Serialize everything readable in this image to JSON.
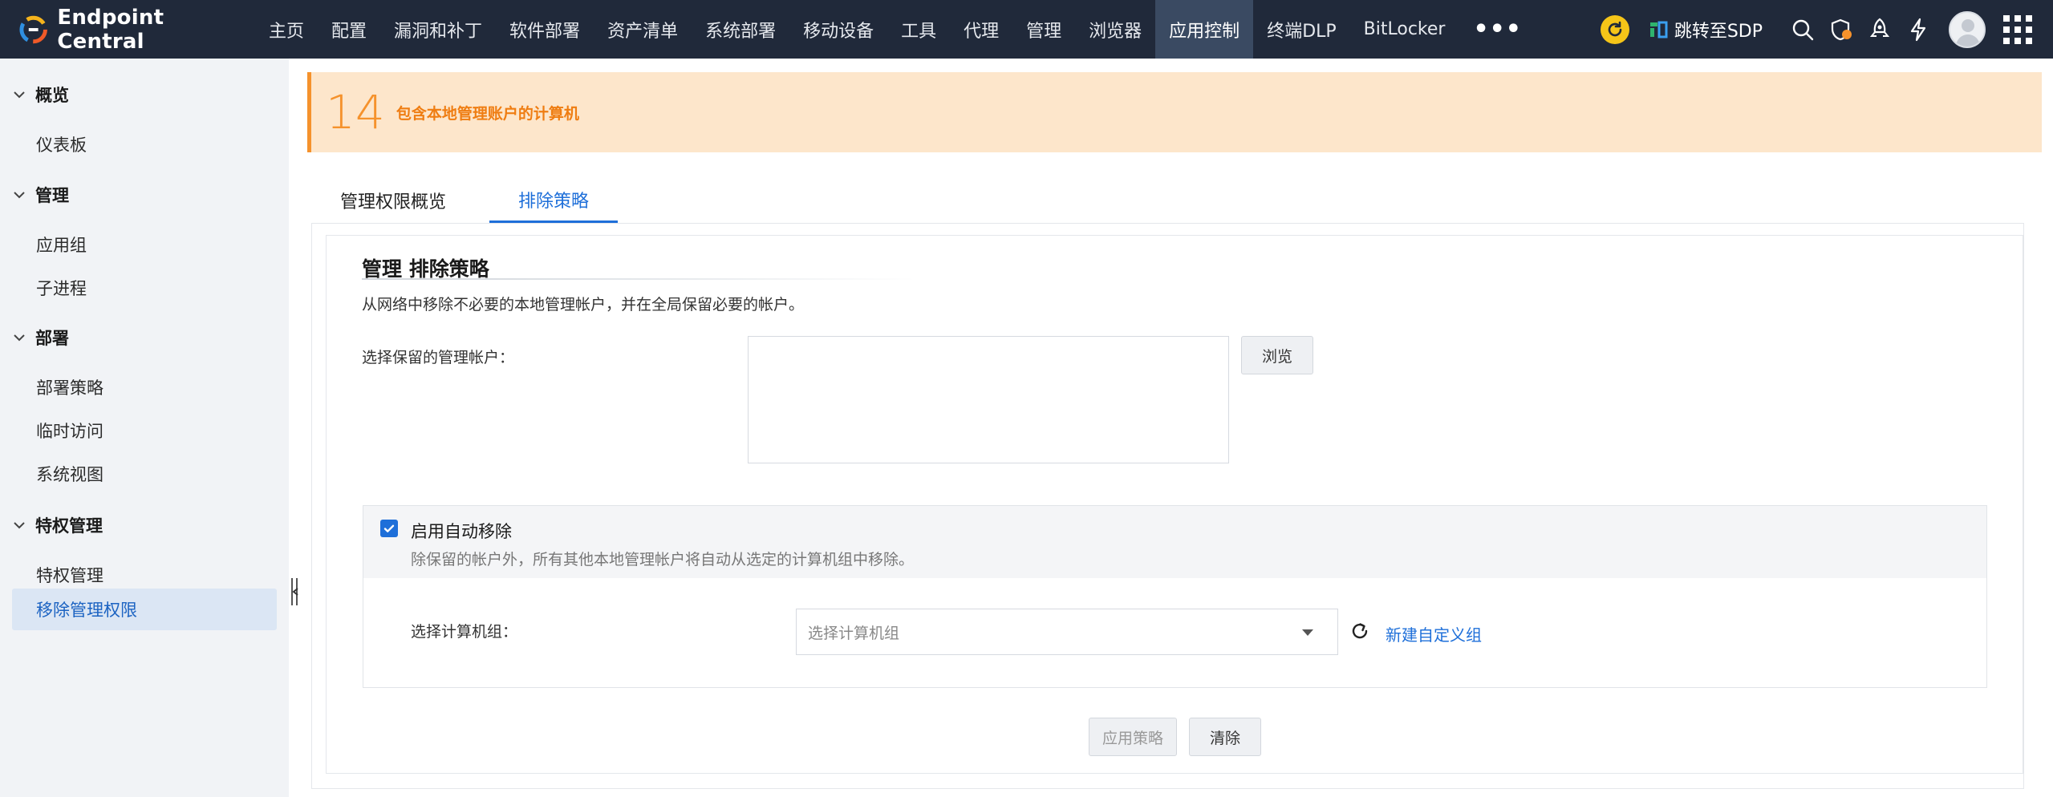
{
  "brand": {
    "name": "Endpoint Central"
  },
  "nav": {
    "items": [
      "主页",
      "配置",
      "漏洞和补丁",
      "软件部署",
      "资产清单",
      "系统部署",
      "移动设备",
      "工具",
      "代理",
      "管理",
      "浏览器",
      "应用控制",
      "终端DLP",
      "BitLocker"
    ],
    "active": "应用控制",
    "more": "•••"
  },
  "topright": {
    "sdp_label": "跳转至SDP"
  },
  "sidebar": {
    "groups": [
      {
        "title": "概览",
        "items": [
          "仪表板"
        ]
      },
      {
        "title": "管理",
        "items": [
          "应用组",
          "子进程"
        ]
      },
      {
        "title": "部署",
        "items": [
          "部署策略",
          "临时访问",
          "系统视图"
        ]
      },
      {
        "title": "特权管理",
        "items": [
          "特权管理",
          "移除管理权限"
        ]
      }
    ],
    "active_item": "移除管理权限"
  },
  "banner": {
    "count": "14",
    "text": "包含本地管理账户的计算机"
  },
  "tabs": {
    "overview": "管理权限概览",
    "exclusion": "排除策略",
    "active": "排除策略"
  },
  "section": {
    "title": "管理 排除策略",
    "description": "从网络中移除不必要的本地管理帐户，并在全局保留必要的帐户。",
    "accounts_label": "选择保留的管理帐户：",
    "browse_button": "浏览"
  },
  "auto_remove": {
    "checked": true,
    "title": "启用自动移除",
    "description": "除保留的帐户外，所有其他本地管理帐户将自动从选定的计算机组中移除。",
    "group_label": "选择计算机组：",
    "group_placeholder": "选择计算机组",
    "new_group_link": "新建自定义组"
  },
  "actions": {
    "apply": "应用策略",
    "clear": "清除"
  },
  "colors": {
    "accent": "#1e6fd9",
    "banner_bg": "#fde6cb",
    "banner_fg": "#f5922c",
    "topbar": "#20293a"
  }
}
